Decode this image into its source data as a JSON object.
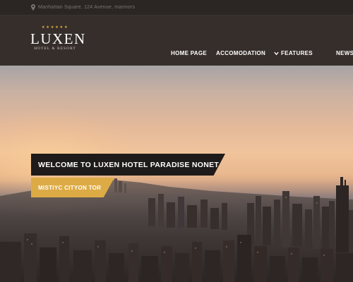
{
  "topbar": {
    "address": "Manhattan Square, 124 Avenue, marmors",
    "location_icon": "map-pin-icon"
  },
  "logo": {
    "stars": "★★★★★★",
    "name": "LUXEN",
    "tagline": "HOTEL & RESORT"
  },
  "nav": {
    "items": [
      {
        "label": "HOME PAGE"
      },
      {
        "label": "ACCOMODATION"
      },
      {
        "label": "FEATURES",
        "icon": "chevron-down-icon"
      },
      {
        "label": "NEWS"
      }
    ]
  },
  "hero": {
    "title": "WELCOME TO LUXEN HOTEL PARADISE NONET",
    "subtitle": "MISTIYC CITYON TOR"
  },
  "colors": {
    "accent": "#ddab45",
    "header_bg": "#352e2b",
    "topbar_bg": "#2b2624",
    "title_bg": "#1f1b1a"
  }
}
